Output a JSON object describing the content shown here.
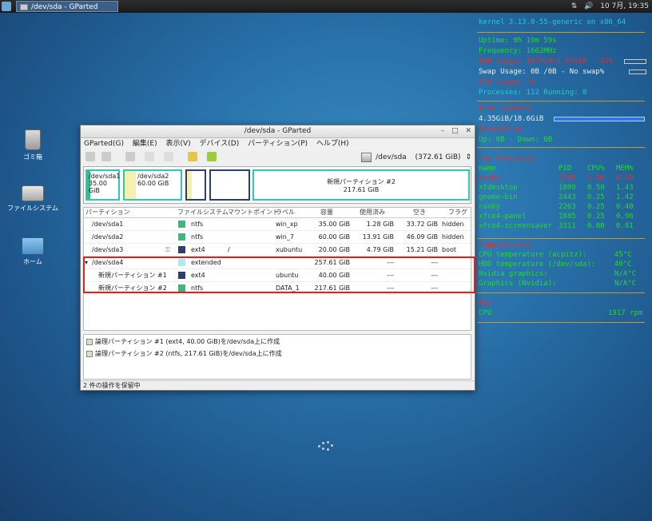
{
  "taskbar": {
    "window_title": "/dev/sda - GParted",
    "clock": "10 7月, 19:35"
  },
  "desktop": {
    "icons": [
      {
        "label": "ゴミ箱"
      },
      {
        "label": "ファイルシステム"
      },
      {
        "label": "ホーム"
      }
    ]
  },
  "conky": {
    "kernel": "kernel 3.13.0-55-generic on x86_64",
    "uptime": "Uptime: 0h 19m 59s",
    "frequency": "Frequency: 1662MHz",
    "ram": "RAM Usage: 951MiB/1.95GiB - 47%",
    "swap": "Swap Usage: 0B /0B - No swap%",
    "cpu_usage": "CPU Usage: 1%",
    "processes": "Processes: 112 Running: 0",
    "fs_label": "File systems",
    "fs_value": "4.35GiB/18.6GiB",
    "network_label": "Networking",
    "network_value": "Up: 0B - Down: 0B",
    "top_label": "Top Processes",
    "top_header": [
      "name",
      "PID",
      "CPU%",
      "MEM%"
    ],
    "top_rows": [
      [
        "conky",
        "1709",
        "1.00",
        "0.99"
      ],
      [
        "xfdesktop",
        "1809",
        "0.50",
        "1.43"
      ],
      [
        "gnome-bin",
        "2443",
        "0.25",
        "1.42"
      ],
      [
        "conky",
        "2263",
        "0.25",
        "0.40"
      ],
      [
        "xfce4-panel",
        "1885",
        "0.25",
        "0.96"
      ],
      [
        "xfce4-screensaver",
        "3311",
        "0.00",
        "0.81"
      ]
    ],
    "temp_label": "Temperatures",
    "temps": [
      [
        "CPU temperature (acpitz):",
        "45°C"
      ],
      [
        "HDD temperature (/dev/sda):",
        "40°C"
      ],
      [
        "Nvidia graphics:",
        "N/A°C"
      ],
      [
        "Graphics (Nvidia):",
        "N/A°C"
      ]
    ],
    "fan_label": "Fan",
    "fan_row": [
      "CPU",
      "1917 rpm"
    ]
  },
  "window": {
    "title": "/dev/sda - GParted",
    "menus": [
      "GParted(G)",
      "編集(E)",
      "表示(V)",
      "デバイス(D)",
      "パーティション(P)",
      "ヘルプ(H)"
    ],
    "device": "/dev/sda",
    "device_size": "(372.61 GiB)",
    "visual": [
      {
        "name": "/dev/sda1",
        "size": "35.00 GiB"
      },
      {
        "name": "/dev/sda2",
        "size": "60.00 GiB"
      },
      {
        "name": "",
        "size": ""
      },
      {
        "name": "",
        "size": ""
      },
      {
        "name": "新規パーティション #2",
        "size": "217.61 GiB"
      }
    ],
    "columns": [
      "パーティション",
      "ファイルシステム",
      "マウントポイント",
      "ラベル",
      "容量",
      "使用済み",
      "空き",
      "フラグ"
    ],
    "rows": [
      {
        "partition": "/dev/sda1",
        "fs": "ntfs",
        "mount": "",
        "label": "win_xp",
        "size": "35.00 GiB",
        "used": "1.28 GiB",
        "free": "33.72 GiB",
        "flags": "hidden",
        "color": "#3cb87a"
      },
      {
        "partition": "/dev/sda2",
        "fs": "ntfs",
        "mount": "",
        "label": "win_7",
        "size": "60.00 GiB",
        "used": "13.91 GiB",
        "free": "46.09 GiB",
        "flags": "hidden",
        "color": "#3cb87a"
      },
      {
        "partition": "/dev/sda3",
        "fs": "ext4",
        "mount": "/",
        "label": "xubuntu",
        "size": "20.00 GiB",
        "used": "4.79 GiB",
        "free": "15.21 GiB",
        "flags": "boot",
        "color": "#2e3e6e"
      },
      {
        "partition": "/dev/sda4",
        "fs": "extended",
        "mount": "",
        "label": "",
        "size": "257.61 GiB",
        "used": "---",
        "free": "---",
        "flags": "",
        "color": "#a9ecf2"
      },
      {
        "partition": "新規パーティション #1",
        "fs": "ext4",
        "mount": "",
        "label": "ubuntu",
        "size": "40.00 GiB",
        "used": "---",
        "free": "---",
        "flags": "",
        "color": "#2e3e6e"
      },
      {
        "partition": "新規パーティション #2",
        "fs": "ntfs",
        "mount": "",
        "label": "DATA_1",
        "size": "217.61 GiB",
        "used": "---",
        "free": "---",
        "flags": "",
        "color": "#3cb87a"
      }
    ],
    "operations": [
      "論理パーティション #1 (ext4, 40.00 GiB)を/dev/sda上に作成",
      "論理パーティション #2 (ntfs, 217.61 GiB)を/dev/sda上に作成"
    ],
    "status": "2 件の操作を保留中"
  }
}
